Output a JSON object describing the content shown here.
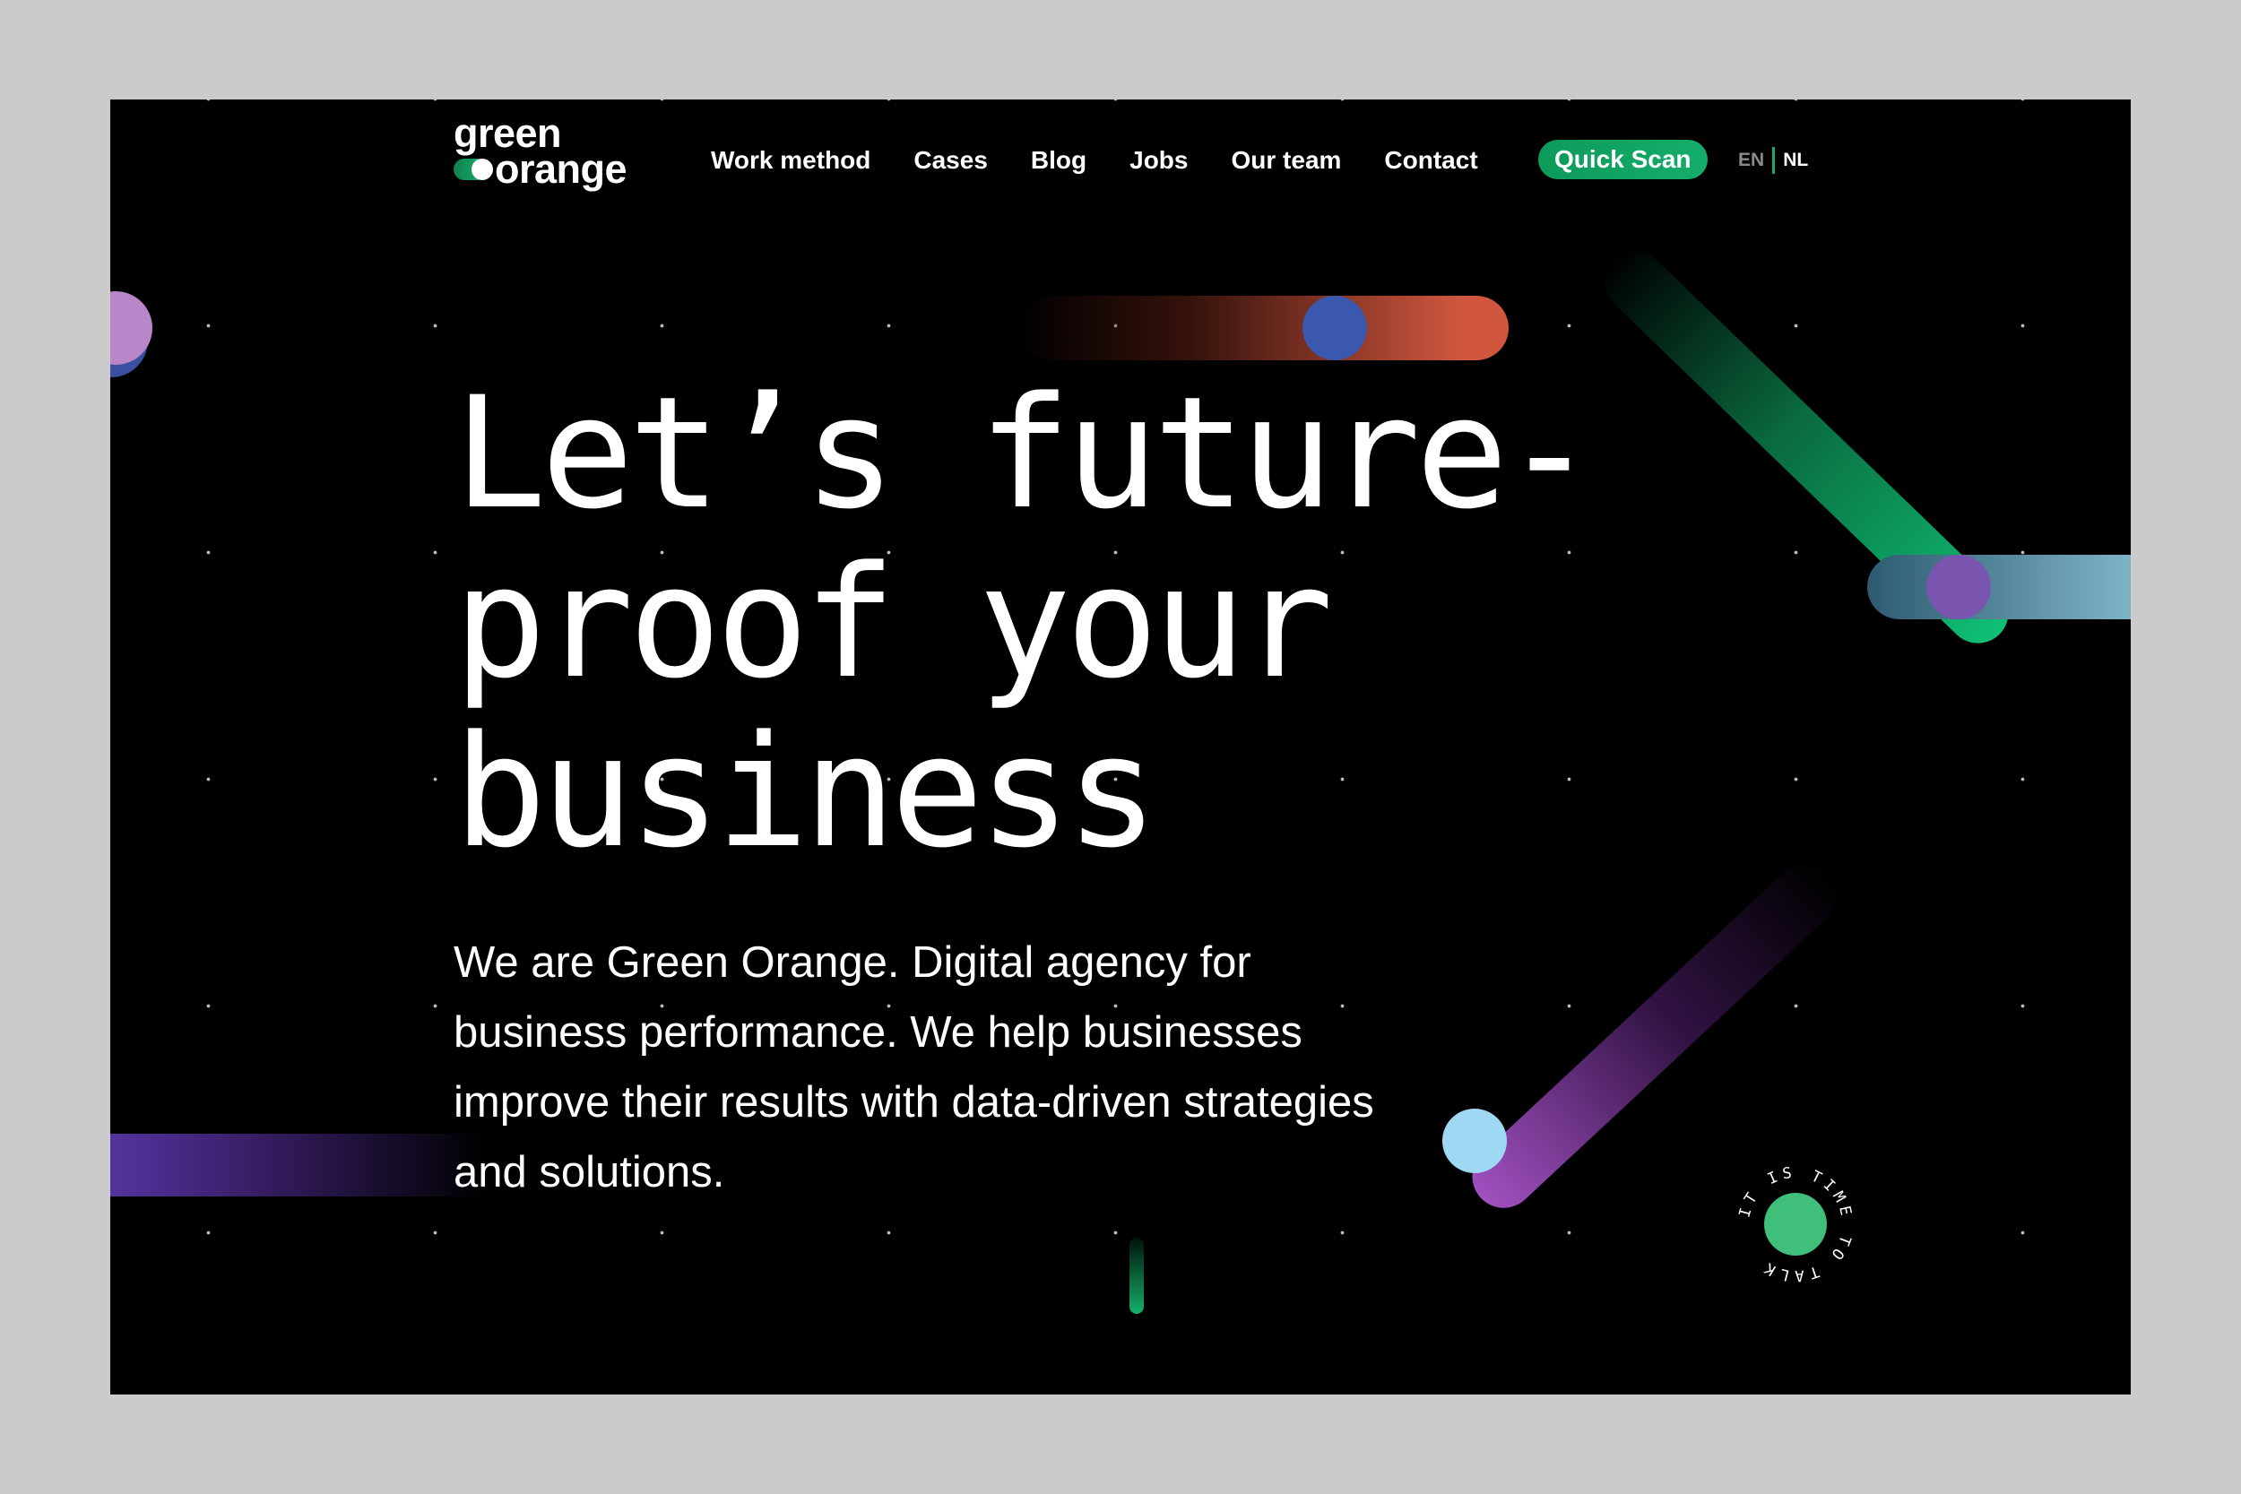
{
  "logo": {
    "line1": "green",
    "line2": "orange"
  },
  "nav": {
    "items": [
      "Work method",
      "Cases",
      "Blog",
      "Jobs",
      "Our team",
      "Contact"
    ],
    "cta": "Quick Scan"
  },
  "language": {
    "current": "EN",
    "other": "NL"
  },
  "hero": {
    "headline": [
      "Let’s future-",
      "proof your",
      "business"
    ],
    "intro": "We are Green Orange. Digital agency for business performance. We help businesses improve their results with data-driven strategies and solutions."
  },
  "talk_badge": {
    "text": "IT IS TIME TO TALK"
  },
  "colors": {
    "brand_green": "#15ad6a",
    "background": "#000000",
    "accent_purple": "#8a4fc8",
    "accent_blue": "#3654a8",
    "accent_orange": "#c8503a"
  }
}
